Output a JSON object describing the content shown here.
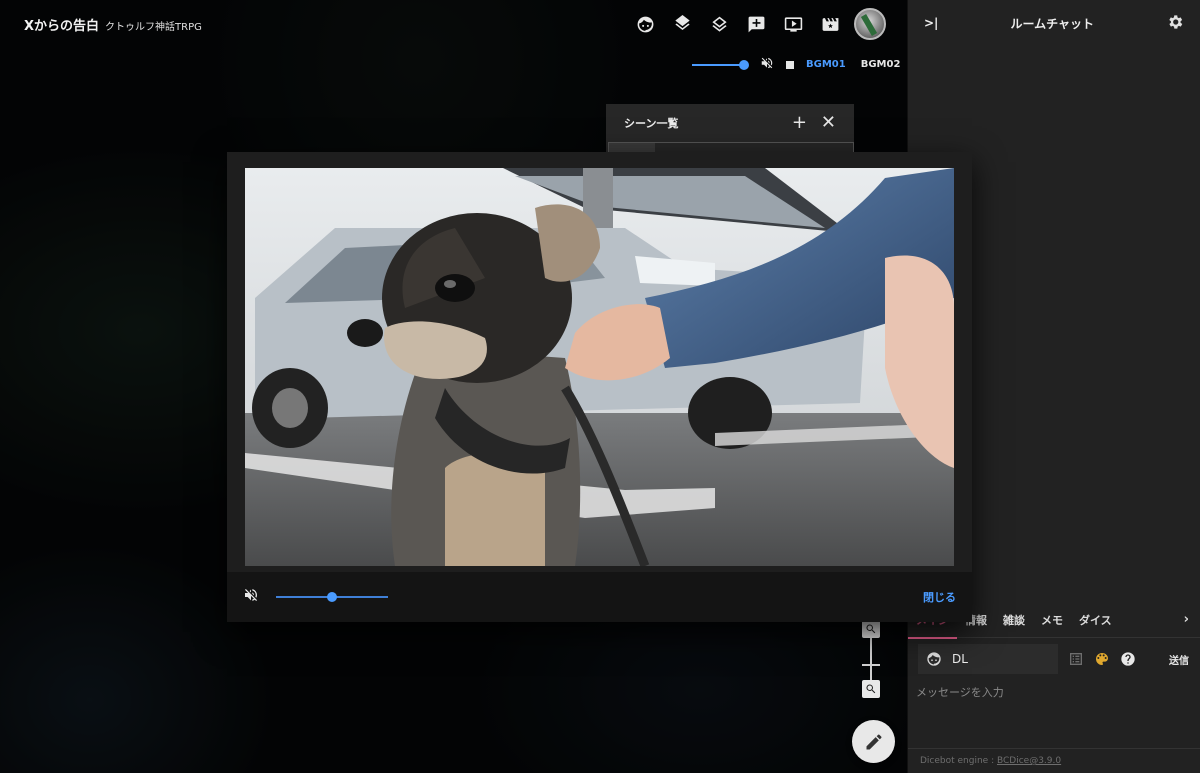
{
  "room": {
    "title": "Xからの告白",
    "subtitle": "クトゥルフ神話TRPG"
  },
  "toolbar": {
    "icons": [
      "face-icon",
      "layers-icon",
      "layers-outline-icon",
      "add-comment-icon",
      "screen-icon",
      "movie-icon",
      "avatar"
    ]
  },
  "bgm": {
    "volume_fraction": 1.0,
    "tabs": [
      "BGM01",
      "BGM02"
    ],
    "active_tab": "BGM01"
  },
  "scene_panel": {
    "title": "シーン一覧"
  },
  "video_modal": {
    "volume_fraction": 0.5,
    "close_label": "閉じる"
  },
  "chat": {
    "title": "ルームチャット",
    "tabs": [
      "メイン",
      "情報",
      "雑談",
      "メモ",
      "ダイス"
    ],
    "active_tab": "メイン",
    "more": "›",
    "character_name": "DL",
    "send_label": "送信",
    "message_placeholder": "メッセージを入力",
    "dicebot_label": "Dicebot engine : ",
    "dicebot_link": "BCDice@3.9.0"
  },
  "colors": {
    "accent": "#4a9bff",
    "chat_tab_active": "#f06292",
    "panel_bg": "#222222"
  }
}
